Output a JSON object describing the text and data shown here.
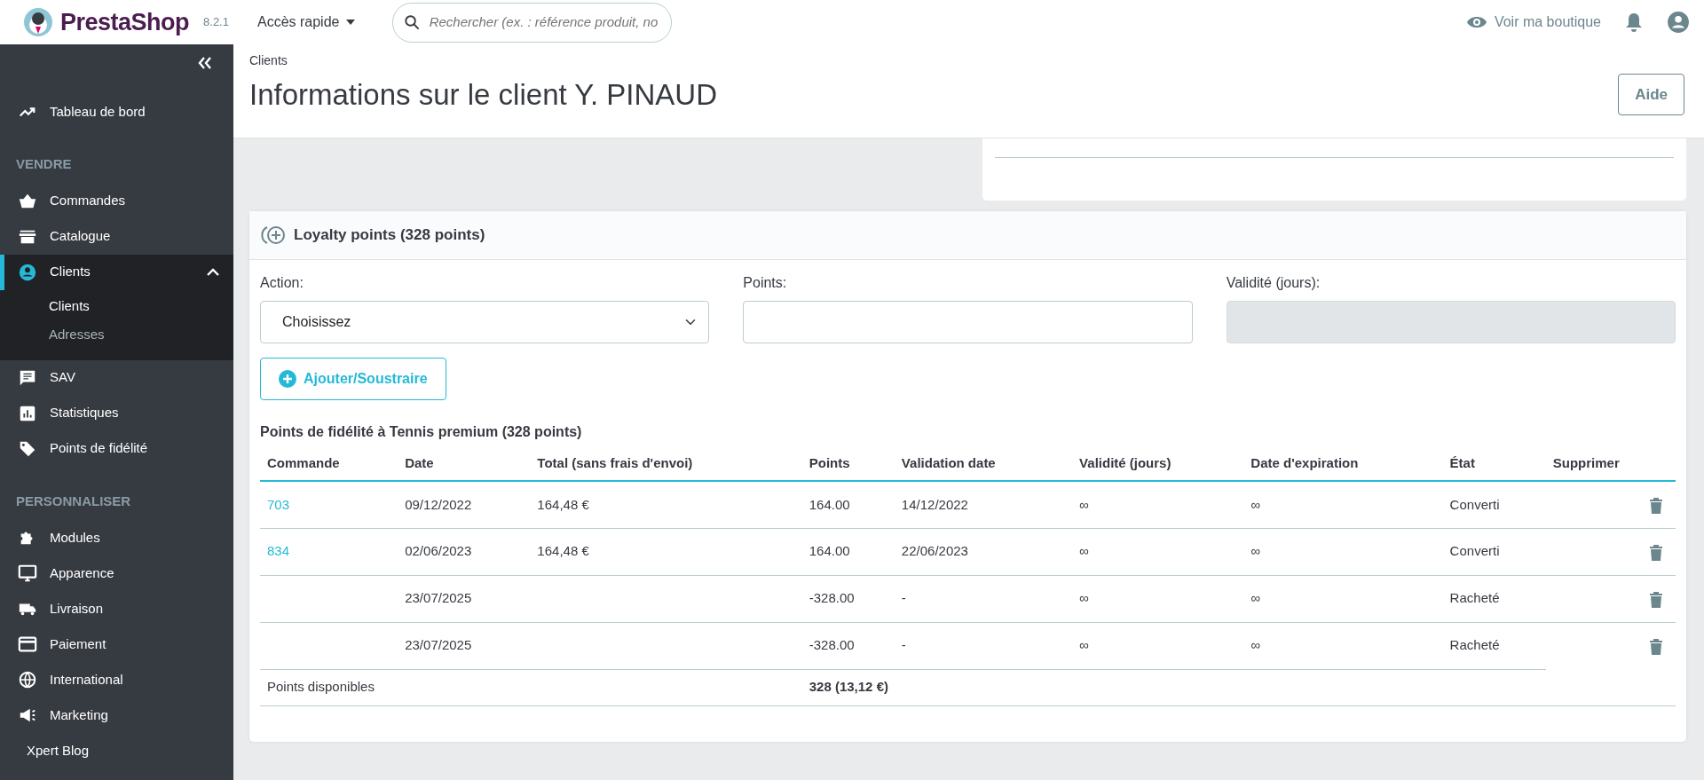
{
  "topbar": {
    "brand": "PrestaShop",
    "version": "8.2.1",
    "quick_access": "Accès rapide",
    "search": {
      "placeholder": "Rechercher (ex. : référence produit, no"
    },
    "shop_link": "Voir ma boutique"
  },
  "sidebar": {
    "items": [
      {
        "kind": "item",
        "label": "Tableau de bord",
        "selected": false
      },
      {
        "kind": "heading",
        "label": "VENDRE"
      },
      {
        "kind": "item",
        "label": "Commandes",
        "selected": false
      },
      {
        "kind": "item",
        "label": "Catalogue",
        "selected": false
      },
      {
        "kind": "item",
        "label": "Clients",
        "selected": true,
        "expanded": true,
        "children": [
          {
            "label": "Clients",
            "selected": true
          },
          {
            "label": "Adresses",
            "selected": false
          }
        ]
      },
      {
        "kind": "item",
        "label": "SAV",
        "selected": false
      },
      {
        "kind": "item",
        "label": "Statistiques",
        "selected": false
      },
      {
        "kind": "item",
        "label": "Points de fidélité",
        "selected": false
      },
      {
        "kind": "heading",
        "label": "PERSONNALISER"
      },
      {
        "kind": "item",
        "label": "Modules",
        "selected": false
      },
      {
        "kind": "item",
        "label": "Apparence",
        "selected": false
      },
      {
        "kind": "item",
        "label": "Livraison",
        "selected": false
      },
      {
        "kind": "item",
        "label": "Paiement",
        "selected": false
      },
      {
        "kind": "item",
        "label": "International",
        "selected": false
      },
      {
        "kind": "item",
        "label": "Marketing",
        "selected": false
      },
      {
        "kind": "plain",
        "label": "Xpert Blog",
        "selected": false
      }
    ]
  },
  "page": {
    "breadcrumb": "Clients",
    "title": "Informations sur le client Y. PINAUD",
    "help_button": "Aide"
  },
  "loyalty": {
    "title": "Loyalty points (328 points)",
    "fields": [
      {
        "kind": "select",
        "label": "Action:",
        "value": "Choisissez",
        "disabled": false
      },
      {
        "kind": "input",
        "label": "Points:",
        "disabled": false
      },
      {
        "kind": "input",
        "label": "Validité (jours):",
        "disabled": true
      }
    ],
    "button": "Ajouter/Soustraire",
    "table_title": "Points de fidélité à Tennis premium (328 points)",
    "columns": [
      "Commande",
      "Date",
      "Total (sans frais d'envoi)",
      "Points",
      "Validation date",
      "Validité (jours)",
      "Date d'expiration",
      "État",
      "Supprimer"
    ],
    "rows": [
      {
        "cells": [
          "703",
          "09/12/2022",
          "164,48 €",
          "164.00",
          "14/12/2022",
          "∞",
          "∞",
          "Converti"
        ]
      },
      {
        "cells": [
          "834",
          "02/06/2023",
          "164,48 €",
          "164.00",
          "22/06/2023",
          "∞",
          "∞",
          "Converti"
        ]
      },
      {
        "cells": [
          "",
          "23/07/2025",
          "",
          "-328.00",
          "-",
          "∞",
          "∞",
          "Racheté"
        ]
      },
      {
        "cells": [
          "",
          "23/07/2025",
          "",
          "-328.00",
          "-",
          "∞",
          "∞",
          "Racheté"
        ]
      }
    ],
    "footer": {
      "label": "Points disponibles",
      "total": "328 (13,12 €)"
    }
  }
}
